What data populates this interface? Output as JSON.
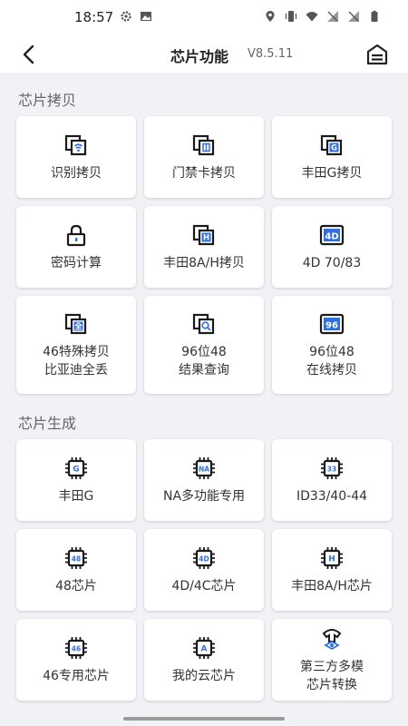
{
  "status_bar": {
    "time": "18:57"
  },
  "header": {
    "title": "芯片功能",
    "version": "V8.5.11"
  },
  "sections": [
    {
      "title": "芯片拷贝",
      "items": [
        {
          "label": "识别拷贝",
          "icon": "copy-wifi-icon",
          "badge": ""
        },
        {
          "label": "门禁卡拷贝",
          "icon": "copy-card-icon",
          "badge": ""
        },
        {
          "label": "丰田G拷贝",
          "icon": "copy-g-icon",
          "badge": "G"
        },
        {
          "label": "密码计算",
          "icon": "lock-icon",
          "badge": ""
        },
        {
          "label": "丰田8A/H拷贝",
          "icon": "copy-h-icon",
          "badge": "H"
        },
        {
          "label": "4D 70/83",
          "icon": "4d-icon",
          "badge": "4D"
        },
        {
          "label": "46特殊拷贝\n比亚迪全丢",
          "icon": "copy-quan-icon",
          "badge": "全"
        },
        {
          "label": "96位48\n结果查询",
          "icon": "copy-search-icon",
          "badge": ""
        },
        {
          "label": "96位48\n在线拷贝",
          "icon": "96-icon",
          "badge": "96"
        }
      ]
    },
    {
      "title": "芯片生成",
      "items": [
        {
          "label": "丰田G",
          "icon": "chip-g-icon",
          "badge": "G"
        },
        {
          "label": "NA多功能专用",
          "icon": "chip-na-icon",
          "badge": "NA"
        },
        {
          "label": "ID33/40-44",
          "icon": "chip-33-icon",
          "badge": "33"
        },
        {
          "label": "48芯片",
          "icon": "chip-48-icon",
          "badge": "48"
        },
        {
          "label": "4D/4C芯片",
          "icon": "chip-4d-icon",
          "badge": "4D"
        },
        {
          "label": "丰田8A/H芯片",
          "icon": "chip-h-icon",
          "badge": "H"
        },
        {
          "label": "46专用芯片",
          "icon": "chip-46-icon",
          "badge": "46"
        },
        {
          "label": "我的云芯片",
          "icon": "chip-cloud-icon",
          "badge": "A"
        },
        {
          "label": "第三方多模\n芯片转换",
          "icon": "chip-convert-icon",
          "badge": ""
        }
      ]
    }
  ],
  "colors": {
    "accent": "#2f6fe0",
    "icon": "#1a1a1a"
  }
}
